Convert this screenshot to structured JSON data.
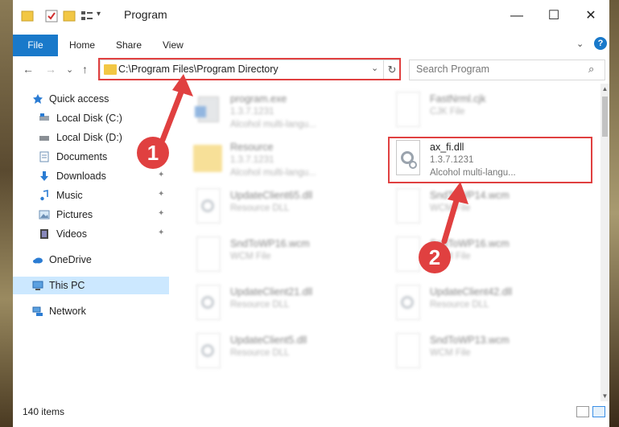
{
  "window": {
    "title": "Program",
    "minimize_icon": "—",
    "maximize_icon": "☐",
    "close_icon": "✕"
  },
  "ribbon": {
    "file": "File",
    "tabs": [
      "Home",
      "Share",
      "View"
    ],
    "expand_icon": "⌄",
    "help_icon": "?"
  },
  "nav": {
    "back": "←",
    "forward": "→",
    "recent": "⌄",
    "up": "↑",
    "address": "C:\\Program Files\\Program Directory",
    "address_dropdown": "⌄",
    "refresh": "↻",
    "search_placeholder": "Search Program",
    "search_icon": "⌕"
  },
  "sidebar": {
    "items": [
      {
        "label": "Quick access"
      },
      {
        "label": "Local Disk (C:)"
      },
      {
        "label": "Local Disk (D:)"
      },
      {
        "label": "Documents"
      },
      {
        "label": "Downloads"
      },
      {
        "label": "Music"
      },
      {
        "label": "Pictures"
      },
      {
        "label": "Videos"
      },
      {
        "label": "OneDrive"
      },
      {
        "label": "This PC"
      },
      {
        "label": "Network"
      }
    ],
    "pin_icon": "📌"
  },
  "files": [
    {
      "name": "program.exe",
      "line1": "1.3.7.1231",
      "line2": "Alcohol multi-langu..."
    },
    {
      "name": "FastNrml.cjk",
      "line1": "CJK File",
      "line2": ""
    },
    {
      "name": "Resource",
      "line1": "1.3.7.1231",
      "line2": "Alcohol multi-langu..."
    },
    {
      "name": "ax_fi.dll",
      "line1": "1.3.7.1231",
      "line2": "Alcohol multi-langu..."
    },
    {
      "name": "UpdateClient65.dll",
      "line1": "Resource DLL",
      "line2": ""
    },
    {
      "name": "SndToWP14.wcm",
      "line1": "WCM File",
      "line2": ""
    },
    {
      "name": "SndToWP16.wcm",
      "line1": "WCM File",
      "line2": ""
    },
    {
      "name": "SndToWP16.wcm",
      "line1": "WCM File",
      "line2": ""
    },
    {
      "name": "UpdateClient21.dll",
      "line1": "Resource DLL",
      "line2": ""
    },
    {
      "name": "UpdateClient42.dll",
      "line1": "Resource DLL",
      "line2": ""
    },
    {
      "name": "UpdateClient5.dll",
      "line1": "Resource DLL",
      "line2": ""
    },
    {
      "name": "SndToWP13.wcm",
      "line1": "WCM File",
      "line2": ""
    }
  ],
  "status": {
    "items": "140 items"
  },
  "annotations": {
    "badge1": "1",
    "badge2": "2",
    "color": "#e04040"
  },
  "colors": {
    "accent": "#1979ca",
    "selected": "#cce8ff",
    "highlight": "#e04040"
  }
}
